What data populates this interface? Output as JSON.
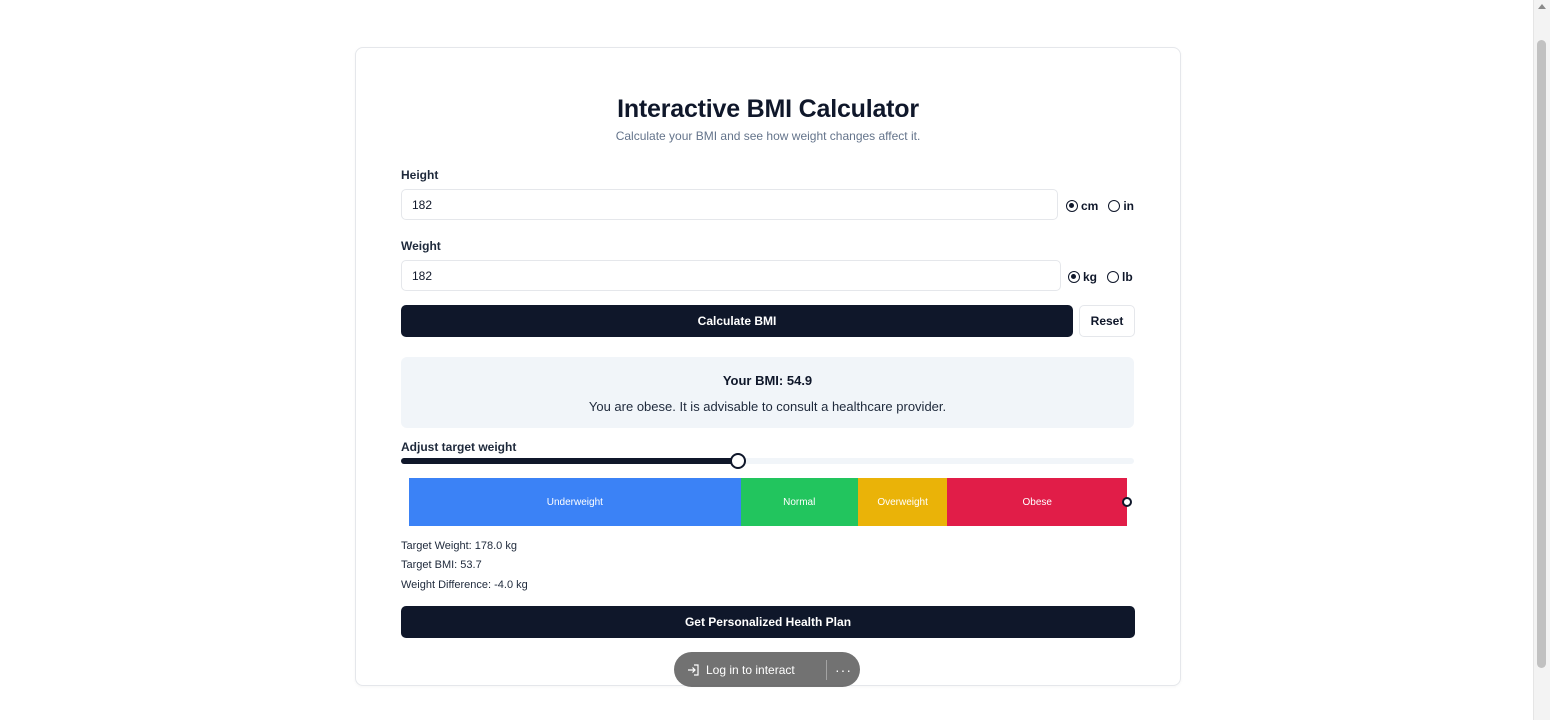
{
  "app": {
    "title": "Interactive BMI Calculator",
    "subtitle": "Calculate your BMI and see how weight changes affect it."
  },
  "height": {
    "label": "Height",
    "value": "182",
    "units": [
      {
        "label": "cm",
        "checked": true
      },
      {
        "label": "in",
        "checked": false
      }
    ]
  },
  "weight": {
    "label": "Weight",
    "value": "182",
    "units": [
      {
        "label": "kg",
        "checked": true
      },
      {
        "label": "lb",
        "checked": false
      }
    ]
  },
  "actions": {
    "calculate_label": "Calculate BMI",
    "reset_label": "Reset",
    "plan_label": "Get Personalized Health Plan"
  },
  "result": {
    "bmi_text": "Your BMI: 54.9",
    "message": "You are obese. It is advisable to consult a healthcare provider."
  },
  "target": {
    "label": "Adjust target weight",
    "slider_fraction": 0.46,
    "weight_text": "Target Weight: 178.0 kg",
    "bmi_text": "Target BMI: 53.7",
    "difference_text": "Weight Difference: -4.0 kg"
  },
  "bmi_scale": {
    "marker_fraction": 1.0,
    "segments": [
      {
        "label": "Underweight",
        "color": "#3b82f6",
        "fraction": 0.462
      },
      {
        "label": "Normal",
        "color": "#22c55e",
        "fraction": 0.163
      },
      {
        "label": "Overweight",
        "color": "#eab308",
        "fraction": 0.125
      },
      {
        "label": "Obese",
        "color": "#e11d48",
        "fraction": 0.25
      }
    ]
  },
  "overlay": {
    "login_label": "Log in to interact",
    "login_icon": "sign-in-icon",
    "more_label": "···"
  },
  "colors": {
    "primary": "#0f172a",
    "muted_bg": "#f1f5f9"
  }
}
